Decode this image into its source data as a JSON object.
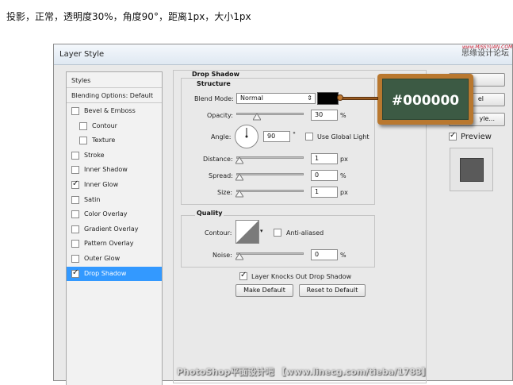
{
  "caption": "投影，正常，透明度30%，角度90°，距离1px，大小1px",
  "window": {
    "title": "Layer Style",
    "watermark_top": "思缘设计论坛",
    "watermark_top2": "www.MISSYUAN.COM",
    "watermark_bottom": "PhotoShop平面设计吧 【www.linecg.com/tieba/1783】"
  },
  "styles_list": {
    "header": "Styles",
    "blending": "Blending Options: Default",
    "items": [
      {
        "label": "Bevel & Emboss",
        "checked": false
      },
      {
        "label": "Contour",
        "checked": false
      },
      {
        "label": "Texture",
        "checked": false
      },
      {
        "label": "Stroke",
        "checked": false
      },
      {
        "label": "Inner Shadow",
        "checked": false
      },
      {
        "label": "Inner Glow",
        "checked": true
      },
      {
        "label": "Satin",
        "checked": false
      },
      {
        "label": "Color Overlay",
        "checked": false
      },
      {
        "label": "Gradient Overlay",
        "checked": false
      },
      {
        "label": "Pattern Overlay",
        "checked": false
      },
      {
        "label": "Outer Glow",
        "checked": false
      },
      {
        "label": "Drop Shadow",
        "checked": true
      }
    ],
    "check_glyph": "✓"
  },
  "drop_shadow": {
    "title": "Drop Shadow",
    "structure_title": "Structure",
    "blend_mode_label": "Blend Mode:",
    "blend_mode_value": "Normal",
    "color": "#000000",
    "opacity_label": "Opacity:",
    "opacity_value": "30",
    "angle_label": "Angle:",
    "angle_value": "90",
    "degree_symbol": "°",
    "use_global_light": "Use Global Light",
    "distance_label": "Distance:",
    "distance_value": "1",
    "spread_label": "Spread:",
    "spread_value": "0",
    "size_label": "Size:",
    "size_value": "1",
    "unit_px": "px",
    "unit_pct": "%",
    "quality_title": "Quality",
    "contour_label": "Contour:",
    "anti_aliased": "Anti-aliased",
    "noise_label": "Noise:",
    "noise_value": "0",
    "knocks_out": "Layer Knocks Out Drop Shadow",
    "make_default": "Make Default",
    "reset_default": "Reset to Default"
  },
  "right_panel": {
    "cancel_partial": "el",
    "new_style_partial": "yle...",
    "preview_label": "Preview"
  },
  "badge_text": "#000000",
  "slider_levels": {
    "opacity": 0.3,
    "distance": 0.0,
    "spread": 0.0,
    "size": 0.0,
    "noise": 0.0
  }
}
